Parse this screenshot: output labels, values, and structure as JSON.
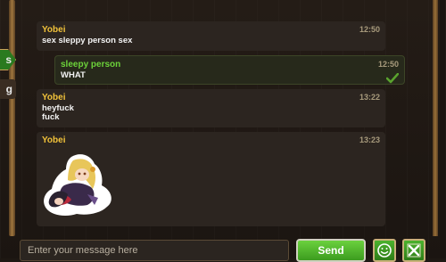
{
  "sidebar": {
    "active_tab_label": "s",
    "inactive_tab_label": "g"
  },
  "messages": [
    {
      "sender": "Yobei",
      "time": "12:50",
      "text": "sex sleppy person sex"
    },
    {
      "sender": "sleepy person",
      "time": "12:50",
      "text": "WHAT",
      "delivered": true
    },
    {
      "sender": "Yobei",
      "time": "13:22",
      "text": "heyfuck\nfuck"
    },
    {
      "sender": "Yobei",
      "time": "13:23",
      "text": "",
      "attachment": "sticker"
    }
  ],
  "composer": {
    "placeholder": "Enter your message here",
    "send_label": "Send",
    "emoji_icon": "smiley-icon",
    "close_icon": "close-icon"
  },
  "colors": {
    "sender_name": "#f1c23a",
    "own_sender_name": "#6cd23a",
    "accent_green": "#4cb22e"
  }
}
